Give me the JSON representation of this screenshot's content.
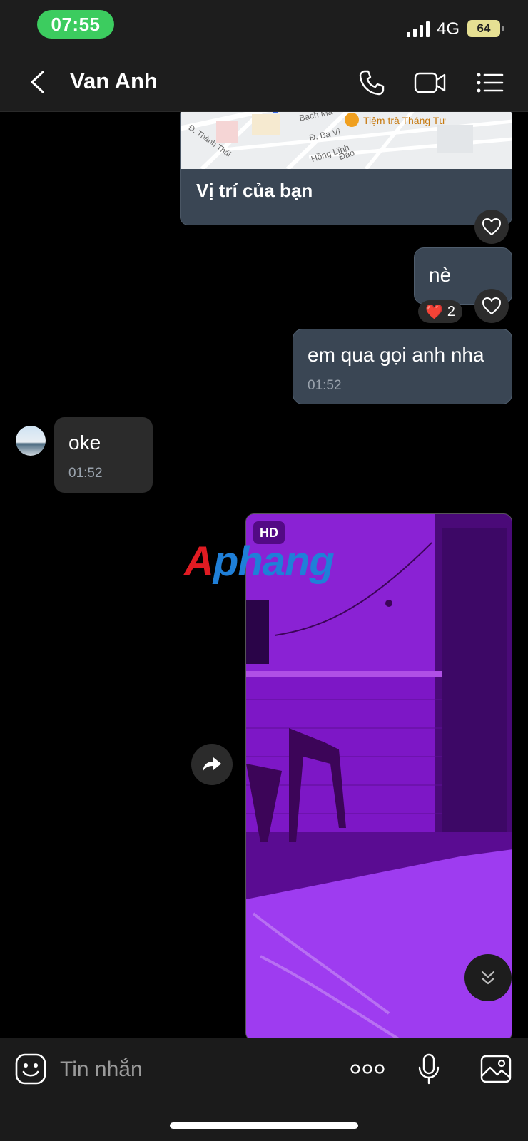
{
  "status_bar": {
    "time": "07:55",
    "network": "4G",
    "battery": "64"
  },
  "header": {
    "contact_name": "Van Anh"
  },
  "messages": {
    "location": {
      "map_labels": [
        "Tiệm trà Tháng Tư",
        "Đ. Ba Vì",
        "Hồng Lĩnh",
        "Đ. Thành Thái",
        "Bạch Mã",
        "Đào"
      ],
      "caption": "Vị trí của bạn"
    },
    "ne": {
      "text": "nè",
      "reaction_emoji": "❤️",
      "reaction_count": "2"
    },
    "call_msg": {
      "text": "em qua gọi anh nha",
      "time": "01:52"
    },
    "oke": {
      "text": "oke",
      "time": "01:52"
    },
    "photo": {
      "badge": "HD"
    }
  },
  "watermark": {
    "first": "A",
    "rest": "phang"
  },
  "composer": {
    "placeholder": "Tin nhắn"
  },
  "colors": {
    "time_pill": "#3ccc5f",
    "outgoing_bubble": "#3a4654",
    "incoming_bubble": "#2b2b2b",
    "photo_tint": "#7c17c4"
  }
}
